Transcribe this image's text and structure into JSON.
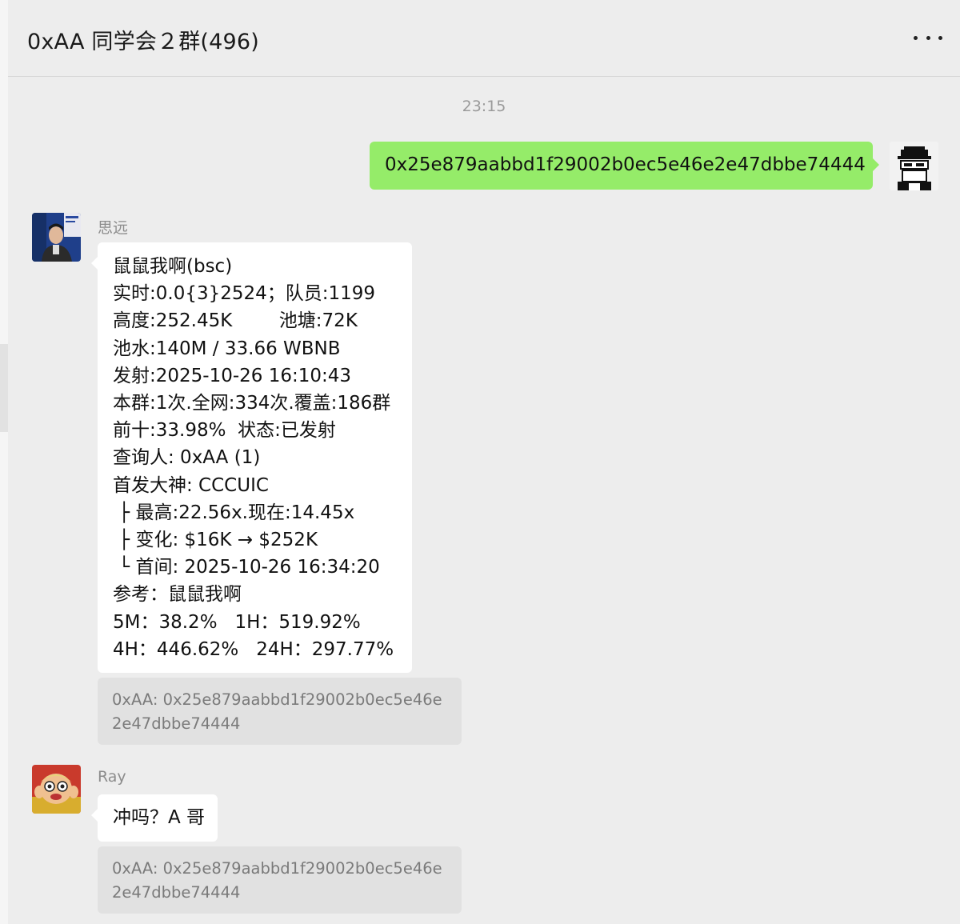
{
  "chat": {
    "title": "0xAA 同学会２群(496)",
    "more_icon": "more-horizontal-icon"
  },
  "timestamp": "23:15",
  "messages": {
    "self": {
      "text": "0x25e879aabbd1f29002b0ec5e46e2e47dbbe74444",
      "bubble_color": "#95ec69"
    },
    "siyuan": {
      "sender": "思远",
      "lines": [
        "鼠鼠我啊(bsc)",
        "实时:0.0{3}2524；队员:1199",
        "高度:252.45K        池塘:72K",
        "池水:140M / 33.66 WBNB",
        "发射:2025-10-26 16:10:43",
        "本群:1次.全网:334次.覆盖:186群",
        "前十:33.98%  状态:已发射",
        "查询人: 0xAA (1)",
        "首发大神: CCCUIC",
        " ├ 最高:22.56x.现在:14.45x",
        " ├ 变化: $16K → $252K",
        " └ 首间: 2025-10-26 16:34:20",
        "参考：鼠鼠我啊",
        "5M：38.2%   1H：519.92%",
        "4H：446.62%   24H：297.77%"
      ],
      "quote": [
        "0xAA: 0x25e879aabbd1f29002b0ec5e46e",
        "2e47dbbe74444"
      ]
    },
    "ray": {
      "sender": "Ray",
      "text": "冲吗？A 哥",
      "quote": [
        "0xAA: 0x25e879aabbd1f29002b0ec5e46e",
        "2e47dbbe74444"
      ]
    }
  },
  "colors": {
    "background": "#ededed",
    "green_bubble": "#95ec69",
    "white_bubble": "#ffffff",
    "quote_bg": "#e1e1e1"
  }
}
